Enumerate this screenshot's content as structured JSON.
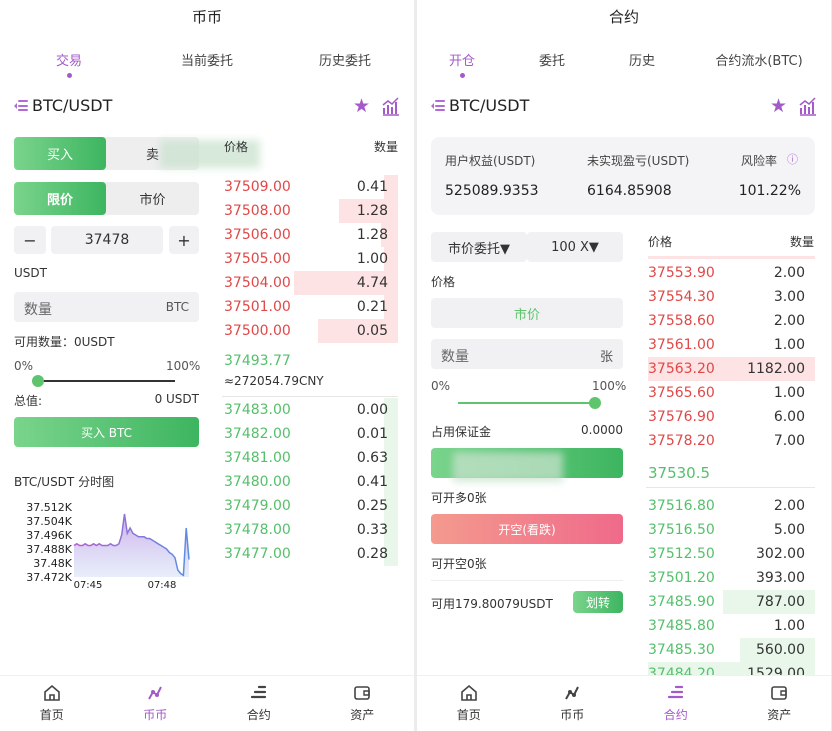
{
  "left": {
    "title": "币币",
    "tabs": [
      "交易",
      "当前委托",
      "历史委托"
    ],
    "pair": "BTC/USDT",
    "side_buy": "买入",
    "side_sell": "卖",
    "order_limit": "限价",
    "order_market": "市价",
    "minus": "−",
    "plus": "+",
    "price_value": "37478",
    "usdt_label": "USDT",
    "qty_placeholder": "数量",
    "qty_unit": "BTC",
    "available": "可用数量：0USDT",
    "slider_min": "0%",
    "slider_max": "100%",
    "slider_level": 0,
    "total_label": "总值:",
    "total_value": "0 USDT",
    "buy_button": "买入 BTC",
    "book_price_header": "价格",
    "book_qty_header": "数量",
    "asks": [
      {
        "price": "37509.00",
        "qty": "0.41",
        "depth": 0.08
      },
      {
        "price": "37508.00",
        "qty": "1.28",
        "depth": 0.34
      },
      {
        "price": "37506.00",
        "qty": "1.28",
        "depth": 0.1
      },
      {
        "price": "37505.00",
        "qty": "1.00",
        "depth": 0.08
      },
      {
        "price": "37504.00",
        "qty": "4.74",
        "depth": 0.6
      },
      {
        "price": "37501.00",
        "qty": "0.21",
        "depth": 0.08
      },
      {
        "price": "37500.00",
        "qty": "0.05",
        "depth": 0.46
      }
    ],
    "last_price": "37493.77",
    "last_cny": "≈272054.79CNY",
    "bids": [
      {
        "price": "37483.00",
        "qty": "0.00",
        "depth": 0.08
      },
      {
        "price": "37482.00",
        "qty": "0.01",
        "depth": 0.08
      },
      {
        "price": "37481.00",
        "qty": "0.63",
        "depth": 0.08
      },
      {
        "price": "37480.00",
        "qty": "0.41",
        "depth": 0.08
      },
      {
        "price": "37479.00",
        "qty": "0.25",
        "depth": 0.08
      },
      {
        "price": "37478.00",
        "qty": "0.33",
        "depth": 0.08
      },
      {
        "price": "37477.00",
        "qty": "0.28",
        "depth": 0.08
      }
    ],
    "mini_chart": {
      "title": "BTC/USDT 分时图",
      "y_labels": [
        "37.512K",
        "37.504K",
        "37.496K",
        "37.488K",
        "37.48K",
        "37.472K"
      ],
      "x_labels": [
        "07:45",
        "07:48"
      ],
      "values": [
        37.49,
        37.491,
        37.49,
        37.49,
        37.491,
        37.49,
        37.49,
        37.491,
        37.49,
        37.491,
        37.49,
        37.49,
        37.49,
        37.491,
        37.49,
        37.49,
        37.491,
        37.496,
        37.508,
        37.497,
        37.5,
        37.497,
        37.496,
        37.495,
        37.495,
        37.495,
        37.494,
        37.494,
        37.493,
        37.492,
        37.491,
        37.49,
        37.489,
        37.488,
        37.486,
        37.485,
        37.483,
        37.476,
        37.474,
        37.473,
        37.5,
        37.482
      ]
    }
  },
  "right": {
    "title": "合约",
    "tabs": [
      "开仓",
      "委托",
      "历史",
      "合约流水(BTC)"
    ],
    "pair": "BTC/USDT",
    "equity_label": "用户权益(USDT)",
    "equity_value": "525089.9353",
    "pnl_label": "未实现盈亏(USDT)",
    "pnl_value": "6164.85908",
    "risk_label": "风险率",
    "risk_value": "101.22%",
    "order_type": "市价委托▼",
    "leverage": "100 X▼",
    "price_label": "价格",
    "market_btn": "市价",
    "qty_placeholder": "数量",
    "qty_unit": "张",
    "slider_min": "0%",
    "slider_max": "100%",
    "slider_level": 100,
    "margin_label": "占用保证金",
    "margin_value": "0.0000",
    "can_long": "可开多0张",
    "short_button": "开空(看跌)",
    "can_short": "可开空0张",
    "available": "可用179.80079USDT",
    "transfer": "划转",
    "book_price_header": "价格",
    "book_qty_header": "数量",
    "asks": [
      {
        "price": "37553.90",
        "qty": "2.00",
        "depth": 0.0
      },
      {
        "price": "37554.30",
        "qty": "3.00",
        "depth": 0.0
      },
      {
        "price": "37558.60",
        "qty": "2.00",
        "depth": 0.0
      },
      {
        "price": "37561.00",
        "qty": "1.00",
        "depth": 0.0
      },
      {
        "price": "37563.20",
        "qty": "1182.00",
        "depth": 1.0
      },
      {
        "price": "37565.60",
        "qty": "1.00",
        "depth": 0.0
      },
      {
        "price": "37576.90",
        "qty": "6.00",
        "depth": 0.0
      },
      {
        "price": "37578.20",
        "qty": "7.00",
        "depth": 0.0
      }
    ],
    "last_price": "37530.5",
    "bids": [
      {
        "price": "37516.80",
        "qty": "2.00",
        "depth": 0.0
      },
      {
        "price": "37516.50",
        "qty": "5.00",
        "depth": 0.0
      },
      {
        "price": "37512.50",
        "qty": "302.00",
        "depth": 0.0
      },
      {
        "price": "37501.20",
        "qty": "393.00",
        "depth": 0.0
      },
      {
        "price": "37485.90",
        "qty": "787.00",
        "depth": 0.55
      },
      {
        "price": "37485.80",
        "qty": "1.00",
        "depth": 0.0
      },
      {
        "price": "37485.30",
        "qty": "560.00",
        "depth": 0.45
      },
      {
        "price": "37484.20",
        "qty": "1529.00",
        "depth": 1.0
      }
    ]
  },
  "nav": {
    "home": "首页",
    "spot": "币币",
    "contract": "合约",
    "assets": "资产"
  },
  "colors": {
    "accent": "#a45ac8",
    "red": "#e04848",
    "green": "#55c06b"
  }
}
